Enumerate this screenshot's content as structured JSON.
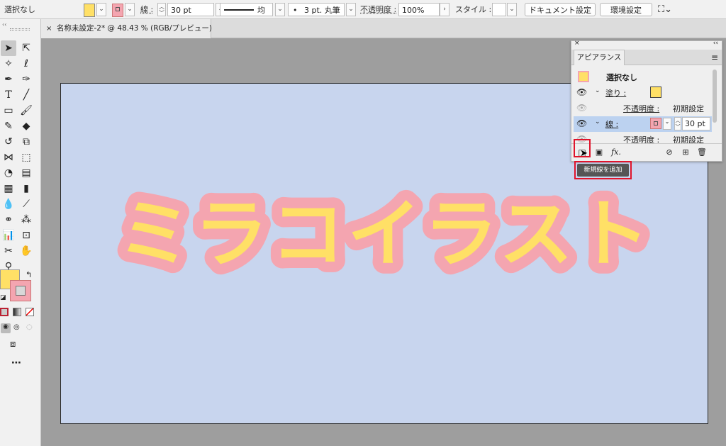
{
  "control_bar": {
    "selection_label": "選択なし",
    "fill_color": "#ffe066",
    "stroke_color": "#f4a5b0",
    "stroke_label": "線 :",
    "stroke_weight": "30 pt",
    "profile_label": "均等",
    "brush_label": "3 pt. 丸筆",
    "opacity_label": "不透明度 :",
    "opacity_value": "100%",
    "style_label": "スタイル :",
    "document_setup_button": "ドキュメント設定",
    "preferences_button": "環境設定"
  },
  "document_tab": {
    "close": "×",
    "title": "名称未設定-2* @ 48.43 % (RGB/プレビュー)"
  },
  "artwork": {
    "text": "ミラコイラスト",
    "fill": "#ffe066",
    "stroke": "#f4a5b0",
    "artboard_color": "#c8d5ee"
  },
  "appearance_panel": {
    "tab_label": "アピアランス",
    "object_label": "選択なし",
    "fill_label": "塗り :",
    "fill_opacity_label": "不透明度 :",
    "fill_opacity_value": "初期設定",
    "stroke_label": "線 :",
    "stroke_weight": "30 pt",
    "stroke_opacity_label": "不透明度 :",
    "stroke_opacity_value": "初期設定",
    "fx_label": "fx."
  },
  "tooltip": {
    "text": "新規線を追加"
  }
}
